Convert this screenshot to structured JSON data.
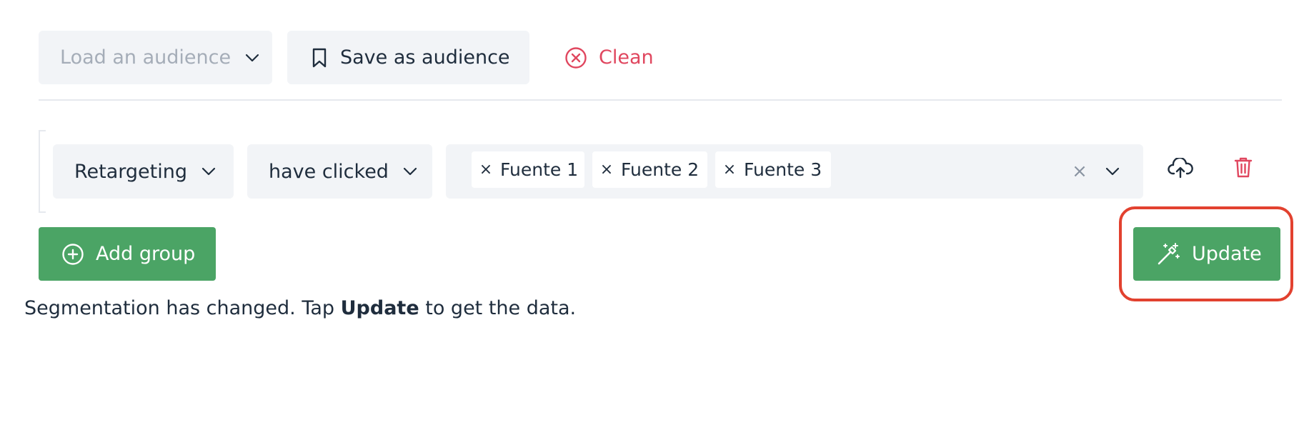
{
  "toolbar": {
    "load_placeholder": "Load an audience",
    "save_label": "Save as audience",
    "clean_label": "Clean"
  },
  "group": {
    "type_value": "Retargeting",
    "action_value": "have clicked",
    "selected_sources": [
      "Fuente 1",
      "Fuente 2",
      "Fuente 3"
    ],
    "remove_chip_glyph": "×",
    "clear_glyph": "×"
  },
  "actions": {
    "add_group_label": "Add group",
    "update_label": "Update"
  },
  "status": {
    "prefix": "Segmentation has changed. Tap ",
    "emphasis": "Update",
    "suffix": " to get the data."
  },
  "colors": {
    "accent_green": "#4ba465",
    "danger_red": "#e0475f",
    "highlight_red": "#e2412f",
    "field_bg": "#f2f4f7",
    "placeholder_gray": "#a5adb8"
  },
  "icons": {
    "load_chevron": "chevron-down-icon",
    "save": "bookmark-icon",
    "clean": "close-circle-icon",
    "upload": "cloud-upload-icon",
    "delete": "trash-icon",
    "add_group": "plus-circle-icon",
    "update": "magic-wand-icon"
  }
}
